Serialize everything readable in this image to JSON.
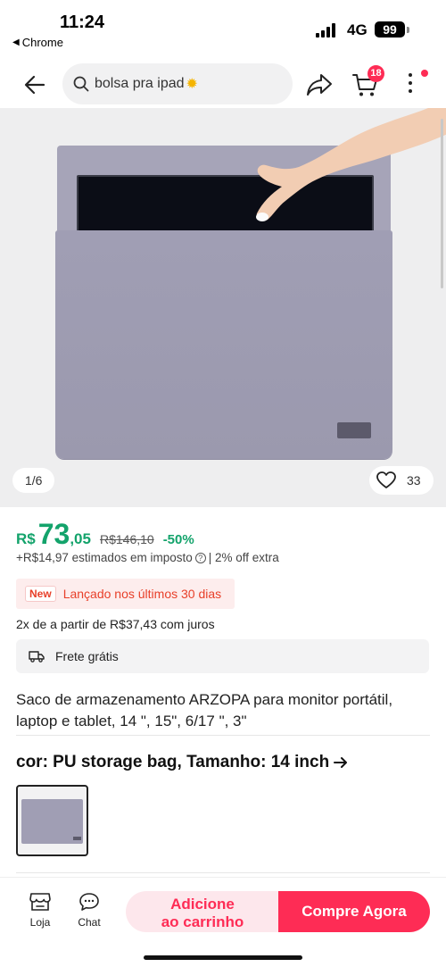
{
  "status_bar": {
    "time": "11:24",
    "back_app": "Chrome",
    "network": "4G",
    "battery": "99"
  },
  "nav": {
    "search_query": "bolsa pra ipad",
    "cart_count": "18",
    "icons": [
      "back-arrow-icon",
      "search-icon",
      "share-icon",
      "cart-icon",
      "more-icon"
    ]
  },
  "gallery": {
    "page_indicator": "1/6",
    "like_count": "33"
  },
  "price": {
    "currency": "R$",
    "integer": "73",
    "decimal": ",05",
    "original": "R$146,10",
    "discount": "-50%",
    "tax_note": "+R$14,97 estimados em imposto",
    "extra_off": "| 2% off extra"
  },
  "launch": {
    "tag": "New",
    "text": "Lançado nos últimos 30 dias"
  },
  "installment": "2x de a partir de R$37,43 com juros",
  "shipping": "Frete grátis",
  "title": "Saco de armazenamento ARZOPA para monitor portátil, laptop e tablet, 14 \", 15\", 6/17 \", 3\"",
  "variant": {
    "label": "cor: PU storage bag, Tamanho: 14 inch"
  },
  "bottom_bar": {
    "shop_label": "Loja",
    "chat_label": "Chat",
    "add_to_cart_line1": "Adicione",
    "add_to_cart_line2": "ao carrinho",
    "buy_now": "Compre Agora"
  },
  "colors": {
    "price_green": "#13a36b",
    "accent_red": "#fe2c55",
    "bag_lavender": "#a09eb4"
  }
}
